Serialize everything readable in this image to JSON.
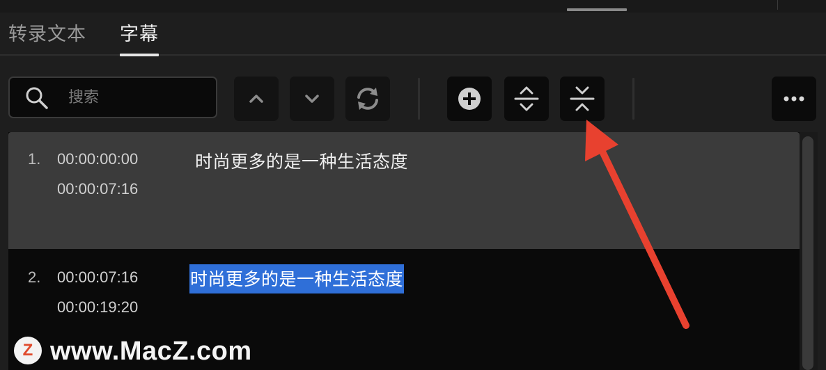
{
  "tabs": {
    "transcript": "转录文本",
    "captions": "字幕"
  },
  "search": {
    "placeholder": "搜索"
  },
  "captions": [
    {
      "index": "1.",
      "in": "00:00:00:00",
      "out": "00:00:07:16",
      "text": "时尚更多的是一种生活态度"
    },
    {
      "index": "2.",
      "in": "00:00:07:16",
      "out": "00:00:19:20",
      "text": "时尚更多的是一种生活态度"
    }
  ],
  "watermark": {
    "logo_letter": "Z",
    "text": "www.MacZ.com"
  },
  "colors": {
    "panel_bg": "#1e1e1e",
    "selected_row_bg": "#3b3b3b",
    "text_highlight": "#2f6fd8",
    "annotation_arrow": "#e8412f"
  },
  "icons": {
    "search": "magnifier-icon",
    "prev": "chevron-up-icon",
    "next": "chevron-down-icon",
    "sync": "refresh-icon",
    "add": "plus-circle-icon",
    "split": "split-caption-icon",
    "merge": "merge-caption-icon",
    "more": "more-horizontal-icon"
  }
}
